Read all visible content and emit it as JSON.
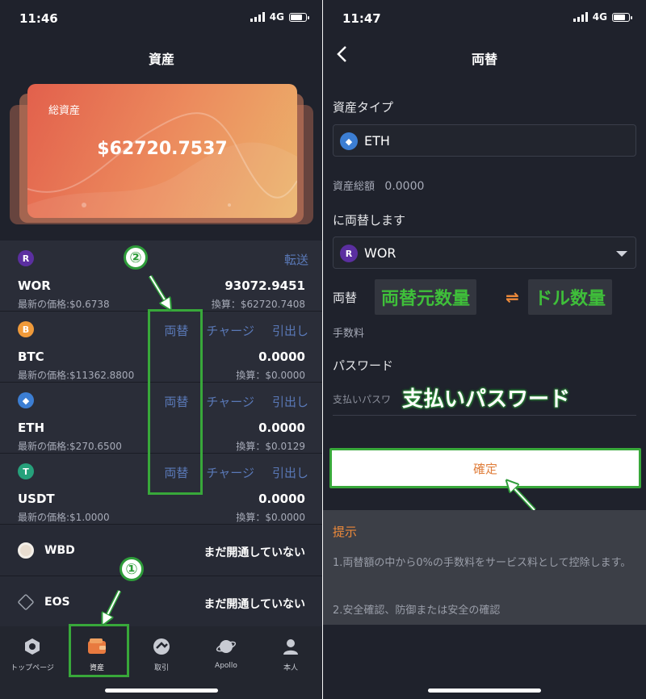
{
  "left": {
    "status": {
      "time": "11:46",
      "network": "4G"
    },
    "title": "資産",
    "card": {
      "label": "総資産",
      "value": "$62720.7537"
    },
    "coins": [
      {
        "symbol": "WOR",
        "icon_color": "#5b2fa0",
        "icon_glyph": "R",
        "actions": [
          "転送"
        ],
        "amount": "93072.9451",
        "price": "最新の価格:$0.6738",
        "conversion": "換算：$62720.7408"
      },
      {
        "symbol": "BTC",
        "icon_color": "#f09a3a",
        "icon_glyph": "B",
        "actions": [
          "両替",
          "チャージ",
          "引出し"
        ],
        "amount": "0.0000",
        "price": "最新の価格:$11362.8800",
        "conversion": "換算：$0.0000"
      },
      {
        "symbol": "ETH",
        "icon_color": "#3c7ed3",
        "icon_glyph": "◆",
        "actions": [
          "両替",
          "チャージ",
          "引出し"
        ],
        "amount": "0.0000",
        "price": "最新の価格:$270.6500",
        "conversion": "換算：$0.0129"
      },
      {
        "symbol": "USDT",
        "icon_color": "#26a17b",
        "icon_glyph": "T",
        "actions": [
          "両替",
          "チャージ",
          "引出し"
        ],
        "amount": "0.0000",
        "price": "最新の価格:$1.0000",
        "conversion": "換算：$0.0000"
      }
    ],
    "closed_coins": [
      {
        "symbol": "WBD",
        "status": "まだ開通していない"
      },
      {
        "symbol": "EOS",
        "status": "まだ開通していない"
      }
    ],
    "tabs": [
      {
        "label": "トップページ",
        "icon": "hexagon-icon"
      },
      {
        "label": "資産",
        "icon": "wallet-icon"
      },
      {
        "label": "取引",
        "icon": "exchange-icon"
      },
      {
        "label": "Apollo",
        "icon": "planet-icon"
      },
      {
        "label": "本人",
        "icon": "user-icon"
      }
    ],
    "annotations": {
      "step1": "①",
      "step2": "②"
    }
  },
  "right": {
    "status": {
      "time": "11:47",
      "network": "4G"
    },
    "title": "両替",
    "asset_type_label": "資産タイプ",
    "asset_type_value": "ETH",
    "asset_total_label": "資産総額",
    "asset_total_value": "0.0000",
    "convert_to_label": "に両替します",
    "convert_to_value": "WOR",
    "exchange_label": "両替",
    "overlay_source_qty": "両替元数量",
    "swap_symbol": "⇌",
    "overlay_dollar_qty": "ドル数量",
    "fee_label": "手数料",
    "password_label": "パスワード",
    "password_placeholder": "支払いパスワ",
    "overlay_password": "支払いパスワード",
    "confirm_label": "確定",
    "hint_title": "提示",
    "hint_1": "1.両替額の中から0%の手数料をサービス料として控除します。",
    "hint_2": "2.安全確認、防御または安全の確認"
  }
}
